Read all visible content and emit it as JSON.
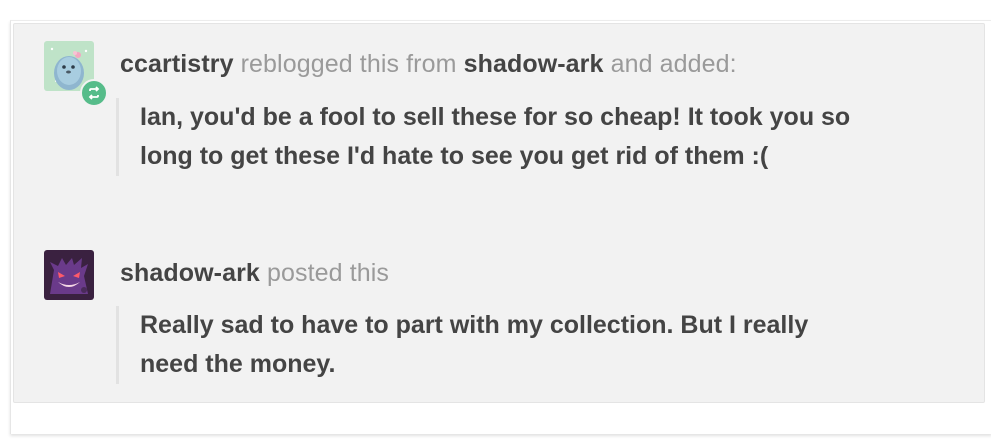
{
  "trail": [
    {
      "blog_name": "ccartistry",
      "action_before": "reblogged this from",
      "source_blog": "shadow-ark",
      "action_after": "and added:",
      "body": "Ian, you'd be a fool to sell these for so cheap! It took you so long to get these I'd hate to see you get rid of them :(",
      "avatar_icon": "seal-avatar-icon",
      "badge_icon": "reblog-icon",
      "badge_color": "#56bc8a"
    },
    {
      "blog_name": "shadow-ark",
      "action": "posted this",
      "body": "Really sad to have to part with my collection. But I really need the money.",
      "avatar_icon": "gengar-avatar-icon"
    }
  ],
  "colors": {
    "trail_background": "#f2f2f2",
    "text_dark": "#444444",
    "text_muted": "#9a9a9a",
    "quote_border": "#e2e2e2"
  }
}
